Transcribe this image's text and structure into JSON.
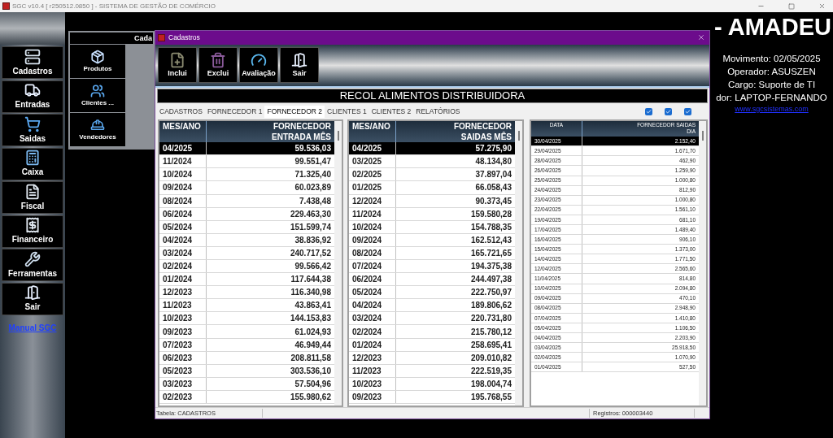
{
  "window": {
    "title": "SGC v10.4 [ r250512.0850 ] - SISTEMA DE GESTÃO DE COMÉRCIO"
  },
  "sidebar": {
    "items": [
      {
        "label": "Cadastros",
        "kind": "stack"
      },
      {
        "label": "Entradas",
        "kind": "truck"
      },
      {
        "label": "Saidas",
        "kind": "cart"
      },
      {
        "label": "Caixa",
        "kind": "register"
      },
      {
        "label": "Fiscal",
        "kind": "file"
      },
      {
        "label": "Financeiro",
        "kind": "receipt"
      },
      {
        "label": "Ferramentas",
        "kind": "tools"
      },
      {
        "label": "Sair",
        "kind": "door"
      }
    ],
    "link": "Manual SGC"
  },
  "back_panel": {
    "title": "Cada",
    "items": [
      {
        "label": "Produtos",
        "kind": "box"
      },
      {
        "label": "Clientes ...",
        "kind": "users"
      },
      {
        "label": "Vendedores",
        "kind": "worker"
      }
    ]
  },
  "heading": "- AMADEU",
  "info": [
    "Movimento: 02/05/2025",
    "Operador: ASUSZEN",
    "Cargo: Suporte de TI",
    "dor: LAPTOP-FERNANDO"
  ],
  "site_link": "www.sgcsistemas.com",
  "dialog": {
    "title": "Cadastros",
    "toolbar": [
      {
        "label": "Inclui",
        "kind": "add"
      },
      {
        "label": "Exclui",
        "kind": "delete"
      },
      {
        "label": "Avaliação",
        "kind": "gauge"
      },
      {
        "label": "Sair",
        "kind": "door"
      }
    ],
    "banner": "RECOL ALIMENTOS DISTRIBUIDORA",
    "tabs": [
      {
        "label": "CADASTROS",
        "selected": false
      },
      {
        "label": "FORNECEDOR 1",
        "selected": false
      },
      {
        "label": "FORNECEDOR 2",
        "selected": true
      },
      {
        "label": "CLIENTES 1",
        "selected": false
      },
      {
        "label": "CLIENTES 2",
        "selected": false
      },
      {
        "label": "RELATÓRIOS",
        "selected": false
      }
    ],
    "checkboxes": [
      {
        "checked": true
      },
      {
        "checked": true
      },
      {
        "checked": true
      }
    ],
    "grids": [
      {
        "kind": "month",
        "columns": [
          "MES/ANO",
          "FORNECEDOR ENTRADA MÊS"
        ],
        "rows": [
          {
            "cells": [
              "04/2025",
              "59.536,03"
            ],
            "selected": true
          },
          {
            "cells": [
              "11/2024",
              "99.551,47"
            ],
            "selected": false
          },
          {
            "cells": [
              "10/2024",
              "71.325,40"
            ],
            "selected": false
          },
          {
            "cells": [
              "09/2024",
              "60.023,89"
            ],
            "selected": false
          },
          {
            "cells": [
              "08/2024",
              "7.438,48"
            ],
            "selected": false
          },
          {
            "cells": [
              "06/2024",
              "229.463,30"
            ],
            "selected": false
          },
          {
            "cells": [
              "05/2024",
              "151.599,74"
            ],
            "selected": false
          },
          {
            "cells": [
              "04/2024",
              "38.836,92"
            ],
            "selected": false
          },
          {
            "cells": [
              "03/2024",
              "240.717,52"
            ],
            "selected": false
          },
          {
            "cells": [
              "02/2024",
              "99.566,42"
            ],
            "selected": false
          },
          {
            "cells": [
              "01/2024",
              "117.644,38"
            ],
            "selected": false
          },
          {
            "cells": [
              "12/2023",
              "116.340,98"
            ],
            "selected": false
          },
          {
            "cells": [
              "11/2023",
              "43.863,41"
            ],
            "selected": false
          },
          {
            "cells": [
              "10/2023",
              "144.153,83"
            ],
            "selected": false
          },
          {
            "cells": [
              "09/2023",
              "61.024,93"
            ],
            "selected": false
          },
          {
            "cells": [
              "07/2023",
              "46.949,44"
            ],
            "selected": false
          },
          {
            "cells": [
              "06/2023",
              "208.811,58"
            ],
            "selected": false
          },
          {
            "cells": [
              "05/2023",
              "303.536,10"
            ],
            "selected": false
          },
          {
            "cells": [
              "03/2023",
              "57.504,96"
            ],
            "selected": false
          },
          {
            "cells": [
              "02/2023",
              "155.980,62"
            ],
            "selected": false
          }
        ]
      },
      {
        "kind": "month",
        "columns": [
          "MES/ANO",
          "FORNECEDOR SAIDAS MÊS"
        ],
        "rows": [
          {
            "cells": [
              "04/2025",
              "57.275,90"
            ],
            "selected": true
          },
          {
            "cells": [
              "03/2025",
              "48.134,80"
            ],
            "selected": false
          },
          {
            "cells": [
              "02/2025",
              "37.897,04"
            ],
            "selected": false
          },
          {
            "cells": [
              "01/2025",
              "66.058,43"
            ],
            "selected": false
          },
          {
            "cells": [
              "12/2024",
              "90.373,45"
            ],
            "selected": false
          },
          {
            "cells": [
              "11/2024",
              "159.580,28"
            ],
            "selected": false
          },
          {
            "cells": [
              "10/2024",
              "154.788,35"
            ],
            "selected": false
          },
          {
            "cells": [
              "09/2024",
              "162.512,43"
            ],
            "selected": false
          },
          {
            "cells": [
              "08/2024",
              "165.721,65"
            ],
            "selected": false
          },
          {
            "cells": [
              "07/2024",
              "194.375,38"
            ],
            "selected": false
          },
          {
            "cells": [
              "06/2024",
              "244.497,38"
            ],
            "selected": false
          },
          {
            "cells": [
              "05/2024",
              "222.750,97"
            ],
            "selected": false
          },
          {
            "cells": [
              "04/2024",
              "189.806,62"
            ],
            "selected": false
          },
          {
            "cells": [
              "03/2024",
              "220.731,80"
            ],
            "selected": false
          },
          {
            "cells": [
              "02/2024",
              "215.780,12"
            ],
            "selected": false
          },
          {
            "cells": [
              "01/2024",
              "258.695,41"
            ],
            "selected": false
          },
          {
            "cells": [
              "12/2023",
              "209.010,82"
            ],
            "selected": false
          },
          {
            "cells": [
              "11/2023",
              "222.519,35"
            ],
            "selected": false
          },
          {
            "cells": [
              "10/2023",
              "198.004,74"
            ],
            "selected": false
          },
          {
            "cells": [
              "09/2023",
              "195.768,55"
            ],
            "selected": false
          }
        ]
      },
      {
        "kind": "day",
        "columns": [
          "DATA",
          "FORNECEDOR SAIDAS DIA"
        ],
        "rows": [
          {
            "cells": [
              "30/04/2025",
              "2.152,40"
            ],
            "selected": true
          },
          {
            "cells": [
              "29/04/2025",
              "1.671,70"
            ],
            "selected": false
          },
          {
            "cells": [
              "28/04/2025",
              "462,90"
            ],
            "selected": false
          },
          {
            "cells": [
              "26/04/2025",
              "1.259,90"
            ],
            "selected": false
          },
          {
            "cells": [
              "25/04/2025",
              "1.000,80"
            ],
            "selected": false
          },
          {
            "cells": [
              "24/04/2025",
              "812,90"
            ],
            "selected": false
          },
          {
            "cells": [
              "23/04/2025",
              "1.000,80"
            ],
            "selected": false
          },
          {
            "cells": [
              "22/04/2025",
              "1.561,10"
            ],
            "selected": false
          },
          {
            "cells": [
              "19/04/2025",
              "681,10"
            ],
            "selected": false
          },
          {
            "cells": [
              "17/04/2025",
              "1.489,40"
            ],
            "selected": false
          },
          {
            "cells": [
              "16/04/2025",
              "906,10"
            ],
            "selected": false
          },
          {
            "cells": [
              "15/04/2025",
              "1.373,00"
            ],
            "selected": false
          },
          {
            "cells": [
              "14/04/2025",
              "1.771,50"
            ],
            "selected": false
          },
          {
            "cells": [
              "12/04/2025",
              "2.565,60"
            ],
            "selected": false
          },
          {
            "cells": [
              "11/04/2025",
              "814,80"
            ],
            "selected": false
          },
          {
            "cells": [
              "10/04/2025",
              "2.094,80"
            ],
            "selected": false
          },
          {
            "cells": [
              "09/04/2025",
              "470,10"
            ],
            "selected": false
          },
          {
            "cells": [
              "08/04/2025",
              "2.948,90"
            ],
            "selected": false
          },
          {
            "cells": [
              "07/04/2025",
              "1.410,80"
            ],
            "selected": false
          },
          {
            "cells": [
              "05/04/2025",
              "1.106,50"
            ],
            "selected": false
          },
          {
            "cells": [
              "04/04/2025",
              "2.203,90"
            ],
            "selected": false
          },
          {
            "cells": [
              "03/04/2025",
              "25.918,50"
            ],
            "selected": false
          },
          {
            "cells": [
              "02/04/2025",
              "1.070,90"
            ],
            "selected": false
          },
          {
            "cells": [
              "01/04/2025",
              "527,50"
            ],
            "selected": false
          }
        ]
      }
    ],
    "status_bar": [
      "Tabela: CADASTROS",
      "Registros: 000003440"
    ]
  }
}
